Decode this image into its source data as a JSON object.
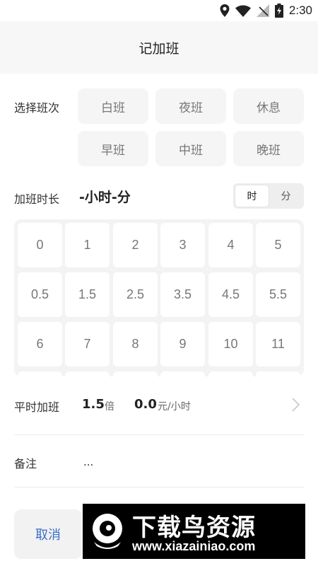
{
  "status_bar": {
    "time": "2:30",
    "icons": [
      "location-icon",
      "wifi-icon",
      "signal-icon",
      "battery-charging-icon"
    ]
  },
  "header": {
    "title": "记加班"
  },
  "shift": {
    "label": "选择班次",
    "options": [
      "白班",
      "夜班",
      "休息",
      "早班",
      "中班",
      "晚班"
    ]
  },
  "duration": {
    "label": "加班时长",
    "value": "-小时-分",
    "units": [
      "时",
      "分"
    ],
    "selected_unit": "时"
  },
  "keypad": {
    "keys": [
      "0",
      "1",
      "2",
      "3",
      "4",
      "5",
      "0.5",
      "1.5",
      "2.5",
      "3.5",
      "4.5",
      "5.5",
      "6",
      "7",
      "8",
      "9",
      "10",
      "11"
    ]
  },
  "overtime": {
    "type": "平时加班",
    "multiplier": "1.5",
    "multiplier_unit": "倍",
    "rate": "0.0",
    "rate_unit": "元/小时"
  },
  "remark": {
    "label": "备注",
    "value": "..."
  },
  "actions": {
    "cancel": "取消"
  },
  "watermark": {
    "text": "下载鸟资源",
    "url": "www.xiazainiao.com"
  },
  "colors": {
    "accent": "#3a6fc4",
    "button_bg": "#f5f5f5",
    "header_bg": "#f7f7f7"
  }
}
